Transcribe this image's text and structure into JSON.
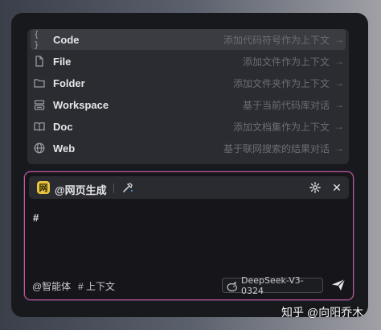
{
  "menu": {
    "items": [
      {
        "icon": "code-braces-icon",
        "label": "Code",
        "desc": "添加代码符号作为上下文"
      },
      {
        "icon": "file-icon",
        "label": "File",
        "desc": "添加文件作为上下文"
      },
      {
        "icon": "folder-icon",
        "label": "Folder",
        "desc": "添加文件夹作为上下文"
      },
      {
        "icon": "workspace-icon",
        "label": "Workspace",
        "desc": "基于当前代码库对话"
      },
      {
        "icon": "book-icon",
        "label": "Doc",
        "desc": "添加文档集作为上下文"
      },
      {
        "icon": "globe-icon",
        "label": "Web",
        "desc": "基于联网搜索的结果对话"
      }
    ],
    "arrow": "→",
    "code_glyph": "{ }"
  },
  "editor": {
    "tag_badge": "网",
    "tag_label": "@网页生成",
    "close_glyph": "✕",
    "input_text": "#",
    "footer_mention": "@智能体",
    "footer_context": "# 上下文",
    "model": "DeepSeek-V3-0324"
  },
  "watermark": "知乎 @向阳乔木",
  "colors": {
    "accent_border": "#c85a8c",
    "badge_yellow": "#e8c440"
  }
}
